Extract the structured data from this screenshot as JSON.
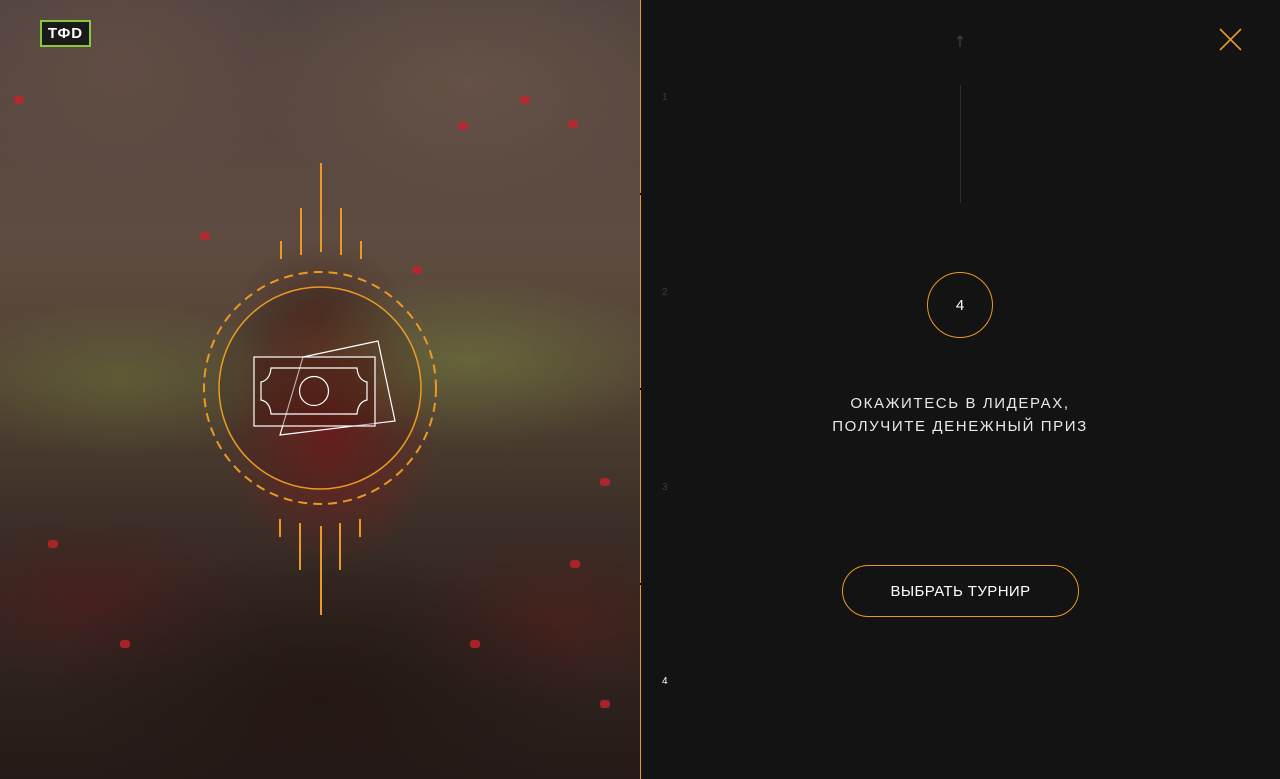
{
  "logo": {
    "text": "ТФD"
  },
  "left_panel": {
    "icon": "money-bills-emblem"
  },
  "nav": {
    "close_icon": "close-icon",
    "up_icon": "arrow-up-icon",
    "steps": [
      {
        "label": "1",
        "active": false
      },
      {
        "label": "2",
        "active": false
      },
      {
        "label": "3",
        "active": false
      },
      {
        "label": "4",
        "active": true
      }
    ]
  },
  "step": {
    "number": "4",
    "title_line1": "ОКАЖИТЕСЬ В ЛИДЕРАХ,",
    "title_line2": "ПОЛУЧИТЕ ДЕНЕЖНЫЙ ПРИЗ"
  },
  "cta": {
    "label": "ВЫБРАТЬ ТУРНИР"
  },
  "colors": {
    "accent": "#ea9a22",
    "logo_green": "#8cc63f",
    "panel_bg": "#131313",
    "text": "#ffffff"
  }
}
